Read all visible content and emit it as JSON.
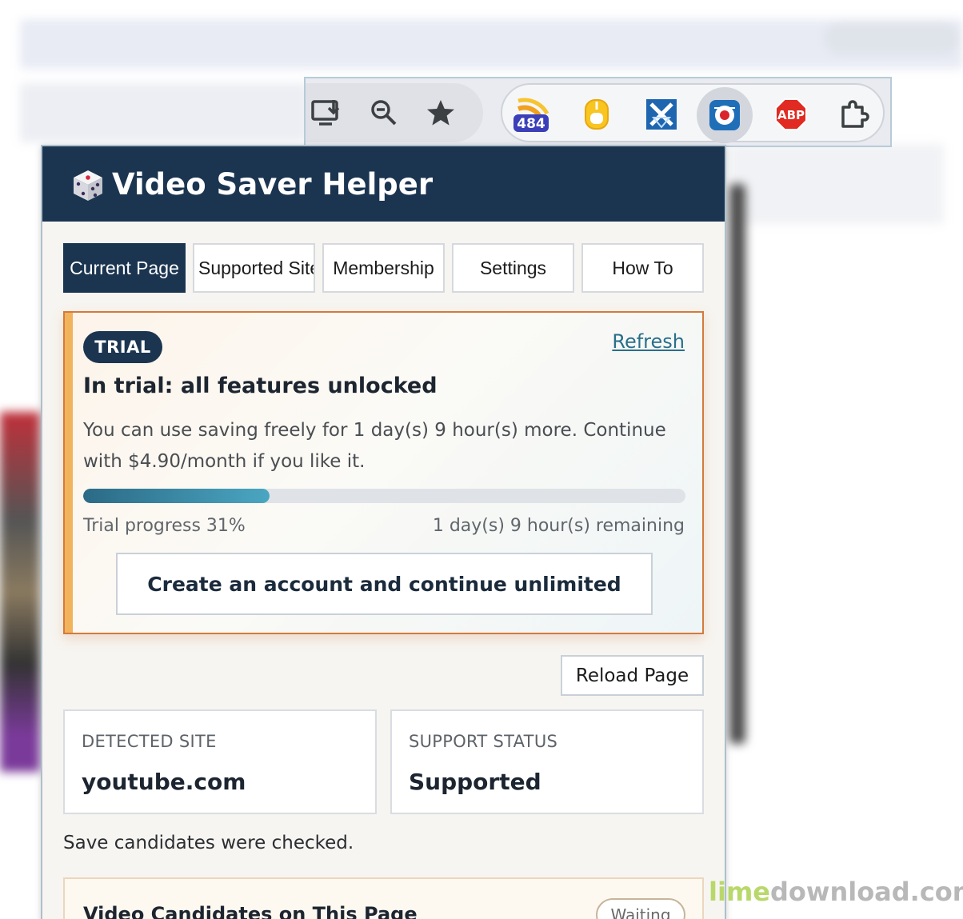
{
  "toolbar": {
    "left_icons": [
      "install-app-icon",
      "zoom-icon",
      "bookmark-star-icon"
    ],
    "extensions": [
      {
        "name": "rss-extension-icon",
        "badge": "484"
      },
      {
        "name": "mouse-extension-icon"
      },
      {
        "name": "x-extension-icon"
      },
      {
        "name": "video-saver-extension-icon"
      },
      {
        "name": "adblock-plus-icon",
        "text": "ABP"
      },
      {
        "name": "extensions-puzzle-icon"
      }
    ]
  },
  "popup": {
    "title": "Video Saver Helper",
    "tabs": [
      {
        "label": "Current Page",
        "active": true
      },
      {
        "label": "Supported Sites",
        "active": false
      },
      {
        "label": "Membership",
        "active": false
      },
      {
        "label": "Settings",
        "active": false
      },
      {
        "label": "How To",
        "active": false
      }
    ],
    "trial": {
      "badge": "TRIAL",
      "refresh_label": "Refresh",
      "title": "In trial: all features unlocked",
      "description": "You can use saving freely for 1 day(s) 9 hour(s) more. Continue with $4.90/month if you like it.",
      "progress_percent": 31,
      "progress_label": "Trial progress 31%",
      "remaining_label": "1 day(s) 9 hour(s) remaining",
      "cta_label": "Create an account and continue unlimited"
    },
    "reload_label": "Reload Page",
    "detected_site": {
      "label": "DETECTED SITE",
      "value": "youtube.com"
    },
    "support_status": {
      "label": "SUPPORT STATUS",
      "value": "Supported"
    },
    "checked_text": "Save candidates were checked.",
    "candidates": {
      "title": "Video Candidates on This Page",
      "status": "Waiting"
    }
  },
  "watermark": {
    "part1": "lime",
    "part2": "download.com"
  },
  "colors": {
    "header": "#1b3551",
    "accent_orange": "#d47a3c",
    "progress": "#2b6a86"
  }
}
